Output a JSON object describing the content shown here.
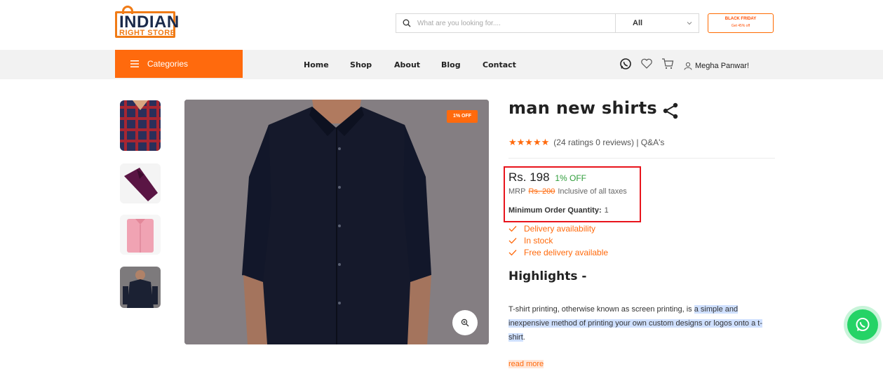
{
  "logo": {
    "line1": "INDIAN",
    "line2": "RIGHT STORE",
    "accent": "#f07b16"
  },
  "search": {
    "placeholder": "What are you looking for....",
    "category": "All"
  },
  "promo": {
    "title": "BLACK FRIDAY",
    "subtitle": "Get 45% off"
  },
  "nav": {
    "categories_label": "Categories",
    "links": [
      "Home",
      "Shop",
      "About",
      "Blog",
      "Contact"
    ],
    "user_name": "Megha Panwar!",
    "icons": [
      "whatsapp-icon",
      "heart-icon",
      "cart-icon",
      "user-icon"
    ]
  },
  "product": {
    "title": "man new shirts",
    "discount_badge": "1% OFF",
    "rating_text": "(24 ratings 0 reviews) | Q&A's",
    "stars": 5,
    "price": "Rs. 198",
    "price_off": "1% OFF",
    "mrp_label": "MRP",
    "mrp_value": "Rs. 200",
    "tax_note": "Inclusive of all taxes",
    "moq_label": "Minimum Order Quantity:",
    "moq_value": "1",
    "features": [
      "Delivery availability",
      "In stock",
      "Free delivery available"
    ],
    "highlights_title": "Highlights -",
    "description_plain": "T-shirt printing, otherwise known as screen printing, is ",
    "description_highlight": "a simple and inexpensive method of printing your own custom designs or logos onto a t-shirt",
    "description_end": ".",
    "read_more": "read more"
  },
  "colors": {
    "brand_orange": "#ff6a0d",
    "highlight_box": "#e8141c",
    "discount_green": "#2e9d3a",
    "whatsapp": "#25d366"
  }
}
